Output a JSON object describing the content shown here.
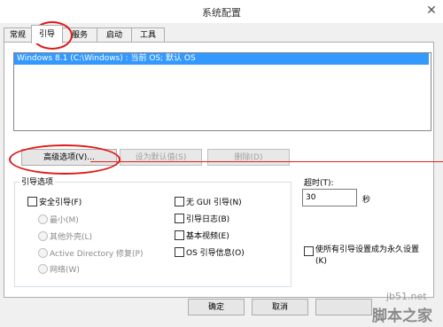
{
  "window": {
    "title": "系统配置",
    "close_glyph": "✕"
  },
  "tabs": [
    {
      "label": "常规"
    },
    {
      "label": "引导"
    },
    {
      "label": "服务"
    },
    {
      "label": "启动"
    },
    {
      "label": "工具"
    }
  ],
  "os_list": {
    "entries": [
      "Windows 8.1 (C:\\Windows) : 当前 OS; 默认 OS"
    ]
  },
  "buttons": {
    "advanced": "高级选项(V)...",
    "set_default": "设为默认值(S)",
    "delete": "删除(D)",
    "ok": "确定",
    "cancel": "取消"
  },
  "boot_options": {
    "group_label": "引导选项",
    "safe_boot": "安全引导(F)",
    "minimal": "最小(M)",
    "alternate_shell": "其他外壳(L)",
    "active_directory": "Active Directory 修复(P)",
    "network": "网络(W)",
    "no_gui": "无 GUI 引导(N)",
    "boot_log": "引导日志(B)",
    "base_video": "基本视频(E)",
    "os_info": "OS 引导信息(O)"
  },
  "timeout": {
    "label": "超时(T):",
    "value": "30",
    "unit": "秒"
  },
  "permanent": "使所有引导设置成为永久设置(K)",
  "watermark": {
    "line1": "jb51.net",
    "line2": "脚本之家"
  },
  "colors": {
    "selection": "#3399ff",
    "annotation": "#e11a1a"
  }
}
